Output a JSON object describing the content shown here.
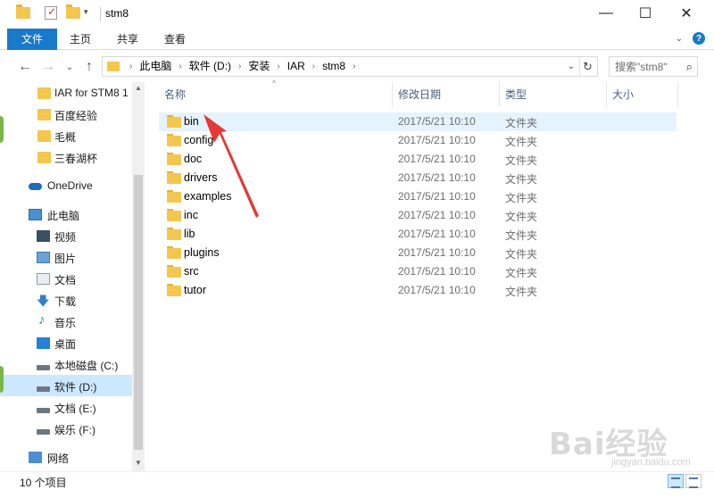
{
  "window": {
    "title": "stm8",
    "minimize_glyph": "—",
    "maximize_glyph": "☐",
    "close_glyph": "✕"
  },
  "ribbon": {
    "tabs": [
      {
        "label": "文件",
        "active": true
      },
      {
        "label": "主页"
      },
      {
        "label": "共享"
      },
      {
        "label": "查看"
      }
    ],
    "expand_glyph": "⌄",
    "help_glyph": "?"
  },
  "nav_buttons": {
    "back": "←",
    "forward": "→",
    "recent": "⌄",
    "up": "↑"
  },
  "address": {
    "crumbs": [
      "此电脑",
      "软件 (D:)",
      "安装",
      "IAR",
      "stm8"
    ],
    "separator": "›",
    "dropdown_glyph": "⌄",
    "refresh_glyph": "↻"
  },
  "search": {
    "placeholder": "搜索\"stm8\"",
    "icon_glyph": "⌕"
  },
  "navpane": {
    "items": [
      {
        "label": "IAR for STM8 1",
        "icon": "folder-icon"
      },
      {
        "label": "百度经验",
        "icon": "folder-icon"
      },
      {
        "label": "毛概",
        "icon": "folder-icon"
      },
      {
        "label": "三春湖杯",
        "icon": "folder-icon"
      },
      {
        "label": "OneDrive",
        "icon": "onedrive-icon"
      },
      {
        "label": "此电脑",
        "icon": "computer-icon"
      },
      {
        "label": "视频",
        "icon": "video-icon"
      },
      {
        "label": "图片",
        "icon": "pictures-icon"
      },
      {
        "label": "文档",
        "icon": "documents-icon"
      },
      {
        "label": "下载",
        "icon": "download-icon"
      },
      {
        "label": "音乐",
        "icon": "music-icon"
      },
      {
        "label": "桌面",
        "icon": "desktop-icon"
      },
      {
        "label": "本地磁盘 (C:)",
        "icon": "drive-icon"
      },
      {
        "label": "软件 (D:)",
        "icon": "drive-icon",
        "selected": true
      },
      {
        "label": "文档 (E:)",
        "icon": "drive-icon"
      },
      {
        "label": "娱乐 (F:)",
        "icon": "drive-icon"
      },
      {
        "label": "网络",
        "icon": "network-icon"
      }
    ],
    "download_glyph": "🡇",
    "music_glyph": "♪"
  },
  "columns": {
    "name": "名称",
    "date": "修改日期",
    "type": "类型",
    "size": "大小",
    "sort_glyph": "^"
  },
  "files": [
    {
      "name": "bin",
      "date": "2017/5/21 10:10",
      "type": "文件夹"
    },
    {
      "name": "config",
      "date": "2017/5/21 10:10",
      "type": "文件夹"
    },
    {
      "name": "doc",
      "date": "2017/5/21 10:10",
      "type": "文件夹"
    },
    {
      "name": "drivers",
      "date": "2017/5/21 10:10",
      "type": "文件夹"
    },
    {
      "name": "examples",
      "date": "2017/5/21 10:10",
      "type": "文件夹"
    },
    {
      "name": "inc",
      "date": "2017/5/21 10:10",
      "type": "文件夹"
    },
    {
      "name": "lib",
      "date": "2017/5/21 10:10",
      "type": "文件夹"
    },
    {
      "name": "plugins",
      "date": "2017/5/21 10:10",
      "type": "文件夹"
    },
    {
      "name": "src",
      "date": "2017/5/21 10:10",
      "type": "文件夹"
    },
    {
      "name": "tutor",
      "date": "2017/5/21 10:10",
      "type": "文件夹"
    }
  ],
  "status": {
    "item_count": "10 个项目"
  },
  "watermark": {
    "main": "Bai经验",
    "sub": "jingyan.baidu.com"
  },
  "colors": {
    "accent": "#1979ca",
    "folder": "#f3c74d",
    "selection": "#cce8ff",
    "hover": "#e5f3ff",
    "annotation": "#e53935"
  }
}
